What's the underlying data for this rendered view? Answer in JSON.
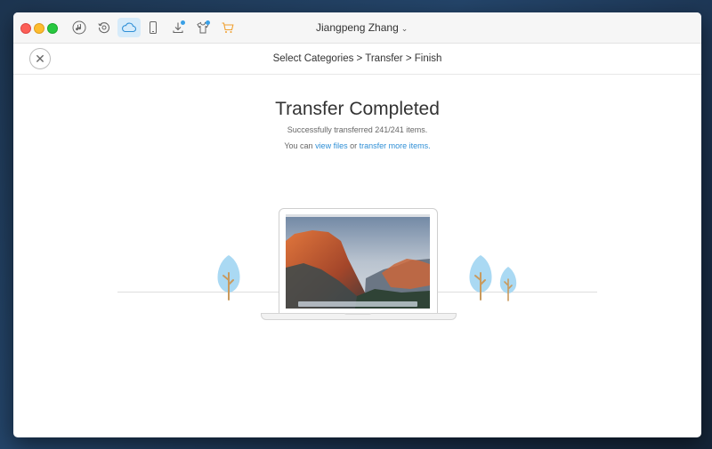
{
  "window": {
    "user_name": "Jiangpeng Zhang",
    "toolbar_icons": [
      "music-icon",
      "history-icon",
      "cloud-icon",
      "phone-icon",
      "download-icon",
      "tshirt-icon",
      "cart-icon"
    ],
    "active_icon": "cloud-icon"
  },
  "nav": {
    "close_glyph": "✕",
    "breadcrumb": "Select Categories > Transfer > Finish"
  },
  "main": {
    "title": "Transfer Completed",
    "subtitle": "Successfully transferred 241/241 items.",
    "prefix": "You can ",
    "view_files_link": "view files",
    "middle": " or ",
    "transfer_more_link": "transfer more items."
  },
  "colors": {
    "accent": "#2f8fd6",
    "tree_leaf": "#aad9f3",
    "tree_trunk": "#c99a5e",
    "cart": "#f0a030"
  }
}
